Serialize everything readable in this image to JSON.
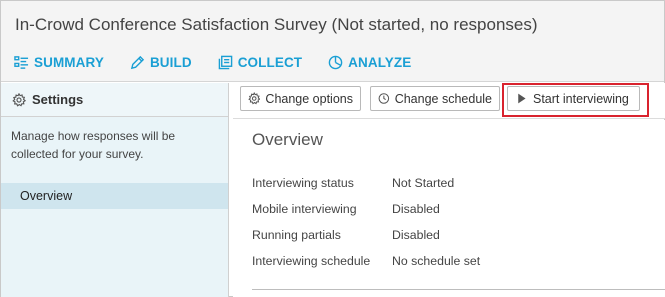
{
  "header": {
    "title": "In-Crowd Conference Satisfaction Survey (Not started, no responses)",
    "nav": [
      {
        "label": "SUMMARY",
        "icon": "summary-icon"
      },
      {
        "label": "BUILD",
        "icon": "pencil-icon"
      },
      {
        "label": "COLLECT",
        "icon": "collect-icon"
      },
      {
        "label": "ANALYZE",
        "icon": "analyze-icon"
      }
    ]
  },
  "sidebar": {
    "heading": "Settings",
    "description": "Manage how responses will be collected for your survey.",
    "items": [
      {
        "label": "Overview"
      }
    ]
  },
  "toolbar": {
    "change_options": "Change options",
    "change_schedule": "Change schedule",
    "start_interviewing": "Start interviewing"
  },
  "main": {
    "title": "Overview",
    "properties": [
      {
        "label": "Interviewing status",
        "value": "Not Started"
      },
      {
        "label": "Mobile interviewing",
        "value": "Disabled"
      },
      {
        "label": "Running partials",
        "value": "Disabled"
      },
      {
        "label": "Interviewing schedule",
        "value": "No schedule set"
      }
    ]
  },
  "colors": {
    "accent": "#1a9fd4",
    "highlight": "#d9232e",
    "sidebar_bg": "#e9f4f8",
    "sidebar_selected": "#cfe5ee"
  }
}
